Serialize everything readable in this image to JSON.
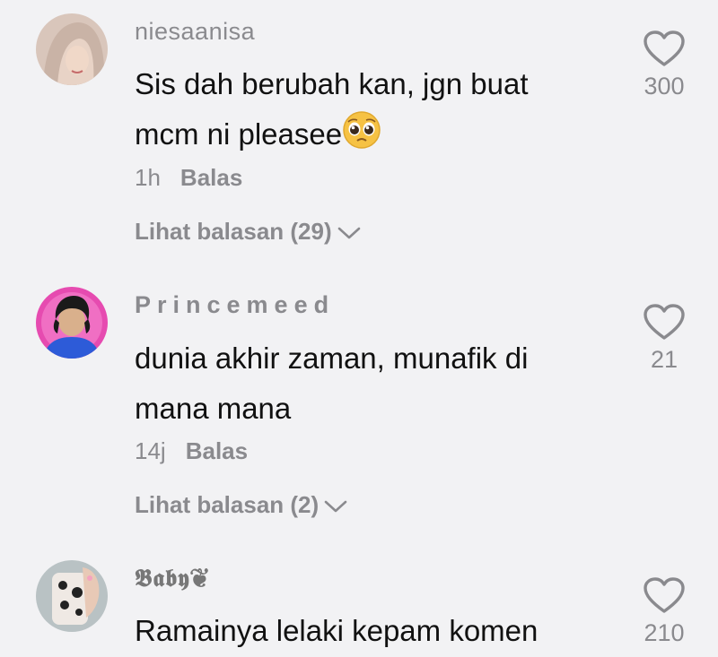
{
  "comments": [
    {
      "username": "niesaanisa",
      "text_lines": [
        "Sis dah berubah kan, jgn buat",
        "mcm ni pleasee"
      ],
      "emoji": "pleading-face-emoji",
      "time": "1h",
      "reply_label": "Balas",
      "view_replies": "Lihat balasan (29)",
      "likes": "300"
    },
    {
      "username": "Princemeed",
      "text_lines": [
        "dunia akhir zaman, munafik di",
        "mana mana"
      ],
      "time": "14j",
      "reply_label": "Balas",
      "view_replies": "Lihat balasan (2)",
      "likes": "21"
    },
    {
      "username": "𝕭𝖆𝖇𝖞❦",
      "text_lines": [
        "Ramainya lelaki kepam komen"
      ],
      "likes": "210"
    }
  ],
  "icons": {
    "like": "heart-outline-icon",
    "expand": "chevron-down-icon"
  },
  "colors": {
    "background": "#f2f2f4",
    "secondary_text": "#8a8a8e",
    "primary_text": "#111111"
  }
}
